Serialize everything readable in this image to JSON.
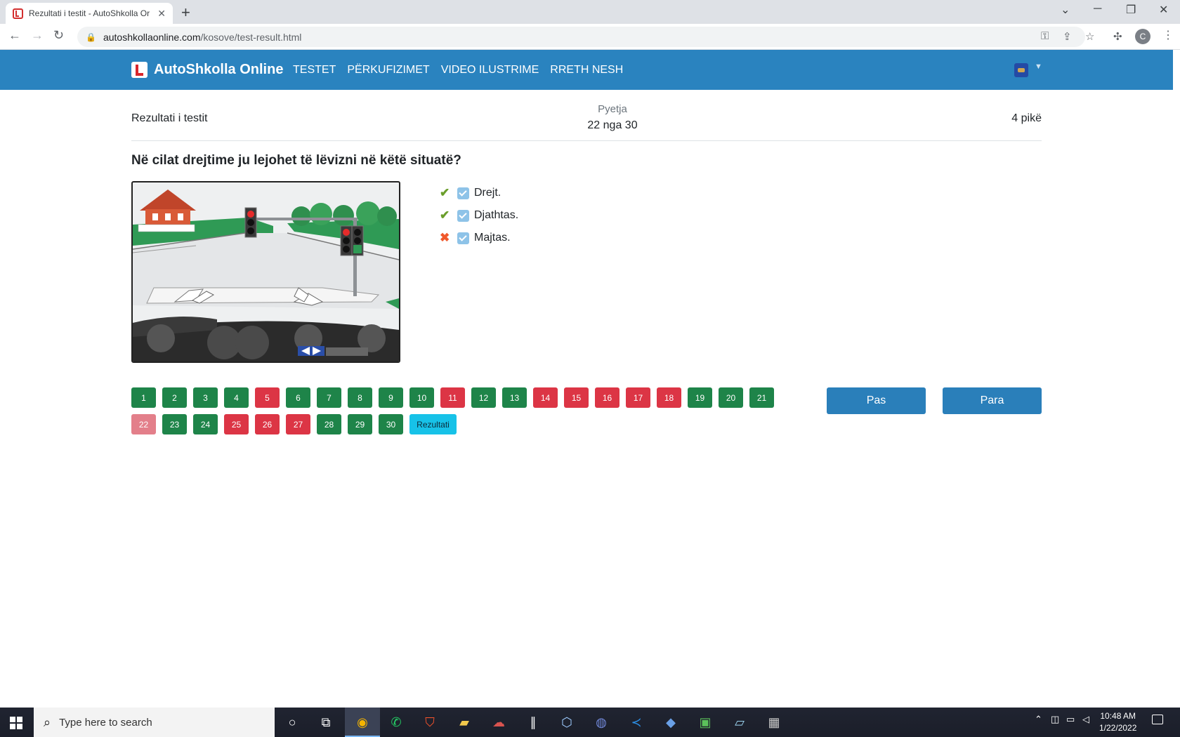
{
  "browser": {
    "tab_title": "Rezultati i testit - AutoShkolla Or",
    "tab_close": "✕",
    "new_tab": "+",
    "url_host": "autoshkollaonline.com",
    "url_path": "/kosove/test-result.html",
    "profile_initial": "C"
  },
  "site": {
    "brand": "AutoShkolla Online",
    "nav": [
      "TESTET",
      "PËRKUFIZIMET",
      "VIDEO ILUSTRIME",
      "RRETH NESH"
    ],
    "accent_color": "#2a83bf"
  },
  "result": {
    "label": "Rezultati i testit",
    "question_label": "Pyetja",
    "question_count": "22 nga 30",
    "points": "4 pikë"
  },
  "question": {
    "text": "Në cilat drejtime ju lejohet të lëvizni në këtë situatë?",
    "answers": [
      {
        "text": "Drejt.",
        "status": "correct",
        "checked": true
      },
      {
        "text": "Djathtas.",
        "status": "correct",
        "checked": true
      },
      {
        "text": "Majtas.",
        "status": "wrong",
        "checked": true
      }
    ]
  },
  "question_grid": [
    {
      "n": "1",
      "state": "green"
    },
    {
      "n": "2",
      "state": "green"
    },
    {
      "n": "3",
      "state": "green"
    },
    {
      "n": "4",
      "state": "green"
    },
    {
      "n": "5",
      "state": "red"
    },
    {
      "n": "6",
      "state": "green"
    },
    {
      "n": "7",
      "state": "green"
    },
    {
      "n": "8",
      "state": "green"
    },
    {
      "n": "9",
      "state": "green"
    },
    {
      "n": "10",
      "state": "green"
    },
    {
      "n": "11",
      "state": "red"
    },
    {
      "n": "12",
      "state": "green"
    },
    {
      "n": "13",
      "state": "green"
    },
    {
      "n": "14",
      "state": "red"
    },
    {
      "n": "15",
      "state": "red"
    },
    {
      "n": "16",
      "state": "red"
    },
    {
      "n": "17",
      "state": "red"
    },
    {
      "n": "18",
      "state": "red"
    },
    {
      "n": "19",
      "state": "green"
    },
    {
      "n": "20",
      "state": "green"
    },
    {
      "n": "21",
      "state": "green"
    },
    {
      "n": "22",
      "state": "current"
    },
    {
      "n": "23",
      "state": "green"
    },
    {
      "n": "24",
      "state": "green"
    },
    {
      "n": "25",
      "state": "red"
    },
    {
      "n": "26",
      "state": "red"
    },
    {
      "n": "27",
      "state": "red"
    },
    {
      "n": "28",
      "state": "green"
    },
    {
      "n": "29",
      "state": "green"
    },
    {
      "n": "30",
      "state": "green"
    }
  ],
  "result_button": "Rezultati",
  "pager": {
    "prev": "Pas",
    "next": "Para"
  },
  "taskbar": {
    "search_placeholder": "Type here to search",
    "time": "10:48 AM",
    "date": "1/22/2022"
  }
}
